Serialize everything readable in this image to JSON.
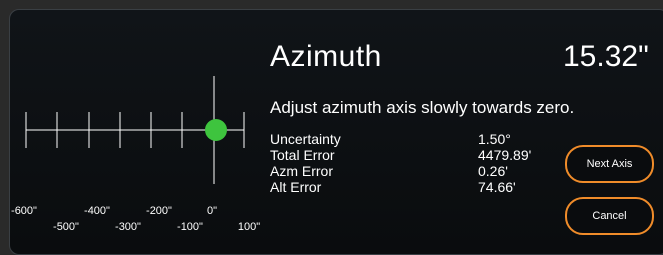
{
  "header": {
    "title": "Azimuth",
    "value": "15.32\""
  },
  "instruction": "Adjust azimuth axis slowly towards zero.",
  "stats": {
    "labels": [
      "Uncertainty",
      "Total Error",
      "Azm Error",
      "Alt Error"
    ],
    "values": [
      "1.50°",
      "4479.89'",
      "0.26'",
      "74.66'"
    ]
  },
  "buttons": {
    "next": "Next Axis",
    "cancel": "Cancel"
  },
  "gauge": {
    "tick_labels_top": [
      "-600\"",
      "-400\"",
      "-200\"",
      "0\""
    ],
    "tick_labels_bottom": [
      "-500\"",
      "-300\"",
      "-100\"",
      "100\""
    ],
    "indicator_value": 15.32,
    "indicator_color": "#3ec43e",
    "line_color": "#ffffff"
  },
  "colors": {
    "accent": "#f08c2a"
  }
}
